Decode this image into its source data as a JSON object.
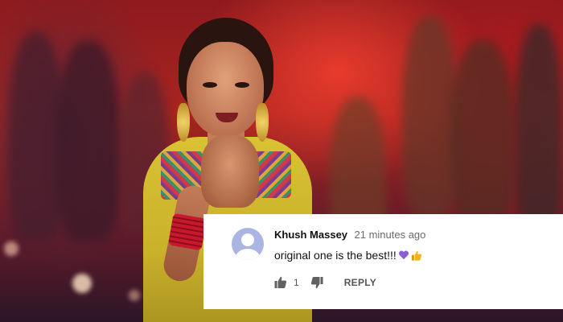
{
  "comment": {
    "author": "Khush Massey",
    "timestamp": "21 minutes ago",
    "text": "original one is the best!!!",
    "emojis": [
      "purple-heart",
      "thumbs-up"
    ],
    "like_count": "1",
    "reply_label": "REPLY"
  },
  "icons": {
    "avatar": "default-user-avatar-icon",
    "like": "thumbs-up-icon",
    "dislike": "thumbs-down-icon"
  },
  "colors": {
    "avatar_bg": "#aab5e2",
    "author_text": "#111111",
    "meta_text": "#6b6b6b",
    "action_text": "#555555",
    "heart": "#8a5fd6",
    "thumbs_emoji": "#f3b21f"
  }
}
